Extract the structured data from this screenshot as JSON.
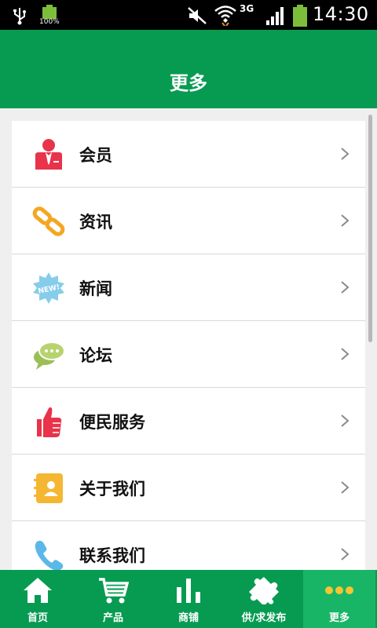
{
  "status_bar": {
    "battery_percent": "100%",
    "network_type": "3G",
    "time": "14:30"
  },
  "header": {
    "title": "更多"
  },
  "menu": [
    {
      "label": "会员",
      "icon": "member-icon"
    },
    {
      "label": "资讯",
      "icon": "link-icon"
    },
    {
      "label": "新闻",
      "icon": "new-badge-icon"
    },
    {
      "label": "论坛",
      "icon": "chat-bubble-icon"
    },
    {
      "label": "便民服务",
      "icon": "thumbs-up-icon"
    },
    {
      "label": "关于我们",
      "icon": "contact-card-icon"
    },
    {
      "label": "联系我们",
      "icon": "phone-icon"
    }
  ],
  "tabs": [
    {
      "label": "首页",
      "icon": "home-icon"
    },
    {
      "label": "产品",
      "icon": "cart-icon"
    },
    {
      "label": "商铺",
      "icon": "bar-chart-icon"
    },
    {
      "label": "供/求发布",
      "icon": "puzzle-icon"
    },
    {
      "label": "更多",
      "icon": "more-dots-icon",
      "active": true
    }
  ],
  "colors": {
    "brand_green": "#079b52",
    "active_tab": "#19b566"
  }
}
